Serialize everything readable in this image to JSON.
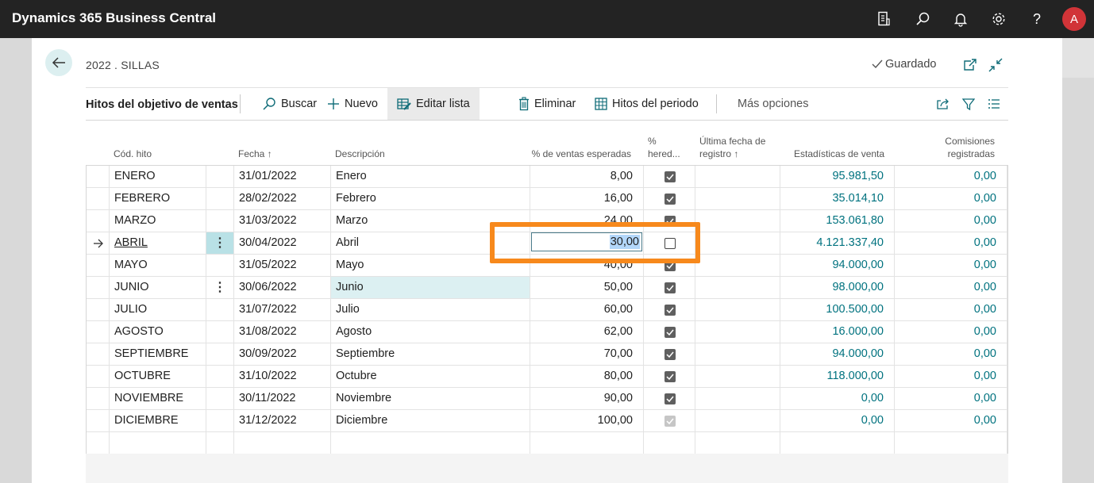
{
  "app": {
    "title": "Dynamics 365 Business Central",
    "user_initial": "A"
  },
  "topbar_icons": [
    "document-icon",
    "search-icon",
    "bell-icon",
    "gear-icon",
    "help-icon"
  ],
  "page": {
    "breadcrumb": "2022 . SILLAS",
    "save_status": "Guardado"
  },
  "actions": {
    "section_title": "Hitos del objetivo de ventas",
    "search": "Buscar",
    "new": "Nuevo",
    "edit_list": "Editar lista",
    "delete": "Eliminar",
    "period_milestones": "Hitos del periodo",
    "more_options": "Más opciones"
  },
  "columns": {
    "code": "Cód. hito",
    "date": "Fecha ↑",
    "description": "Descripción",
    "pct_expected": "% de ventas esperadas",
    "pct_inherited_1": "%",
    "pct_inherited_2": "hered...",
    "last_date_1": "Última fecha de",
    "last_date_2": "registro ↑",
    "sales_stats": "Estadísticas de venta",
    "commissions_1": "Comisiones",
    "commissions_2": "registradas"
  },
  "rows": [
    {
      "code": "ENERO",
      "date": "31/01/2022",
      "description": "Enero",
      "pct": "8,00",
      "inherited": "checked",
      "stats": "95.981,50",
      "commission": "0,00"
    },
    {
      "code": "FEBRERO",
      "date": "28/02/2022",
      "description": "Febrero",
      "pct": "16,00",
      "inherited": "checked",
      "stats": "35.014,10",
      "commission": "0,00"
    },
    {
      "code": "MARZO",
      "date": "31/03/2022",
      "description": "Marzo",
      "pct": "24,00",
      "inherited": "checked",
      "stats": "153.061,80",
      "commission": "0,00"
    },
    {
      "code": "ABRIL",
      "date": "30/04/2022",
      "description": "Abril",
      "pct": "30,00",
      "inherited": "unchecked",
      "stats": "4.121.337,40",
      "commission": "0,00"
    },
    {
      "code": "MAYO",
      "date": "31/05/2022",
      "description": "Mayo",
      "pct": "40,00",
      "inherited": "checked",
      "stats": "94.000,00",
      "commission": "0,00"
    },
    {
      "code": "JUNIO",
      "date": "30/06/2022",
      "description": "Junio",
      "pct": "50,00",
      "inherited": "checked",
      "stats": "98.000,00",
      "commission": "0,00"
    },
    {
      "code": "JULIO",
      "date": "31/07/2022",
      "description": "Julio",
      "pct": "60,00",
      "inherited": "checked",
      "stats": "100.500,00",
      "commission": "0,00"
    },
    {
      "code": "AGOSTO",
      "date": "31/08/2022",
      "description": "Agosto",
      "pct": "62,00",
      "inherited": "checked",
      "stats": "16.000,00",
      "commission": "0,00"
    },
    {
      "code": "SEPTIEMBRE",
      "date": "30/09/2022",
      "description": "Septiembre",
      "pct": "70,00",
      "inherited": "checked",
      "stats": "94.000,00",
      "commission": "0,00"
    },
    {
      "code": "OCTUBRE",
      "date": "31/10/2022",
      "description": "Octubre",
      "pct": "80,00",
      "inherited": "checked",
      "stats": "118.000,00",
      "commission": "0,00"
    },
    {
      "code": "NOVIEMBRE",
      "date": "30/11/2022",
      "description": "Noviembre",
      "pct": "90,00",
      "inherited": "checked",
      "stats": "0,00",
      "commission": "0,00"
    },
    {
      "code": "DICIEMBRE",
      "date": "31/12/2022",
      "description": "Diciembre",
      "pct": "100,00",
      "inherited": "disabled",
      "stats": "0,00",
      "commission": "0,00"
    }
  ],
  "selection": {
    "current_row_code": "ABRIL",
    "editing_value": "30,00",
    "menu_dots_rows": [
      "ABRIL",
      "JUNIO"
    ],
    "highlighted_description_row": "JUNIO"
  },
  "colors": {
    "topbar": "#232323",
    "link": "#00727f",
    "accent_box": "#f7891c",
    "avatar": "#d13438"
  }
}
